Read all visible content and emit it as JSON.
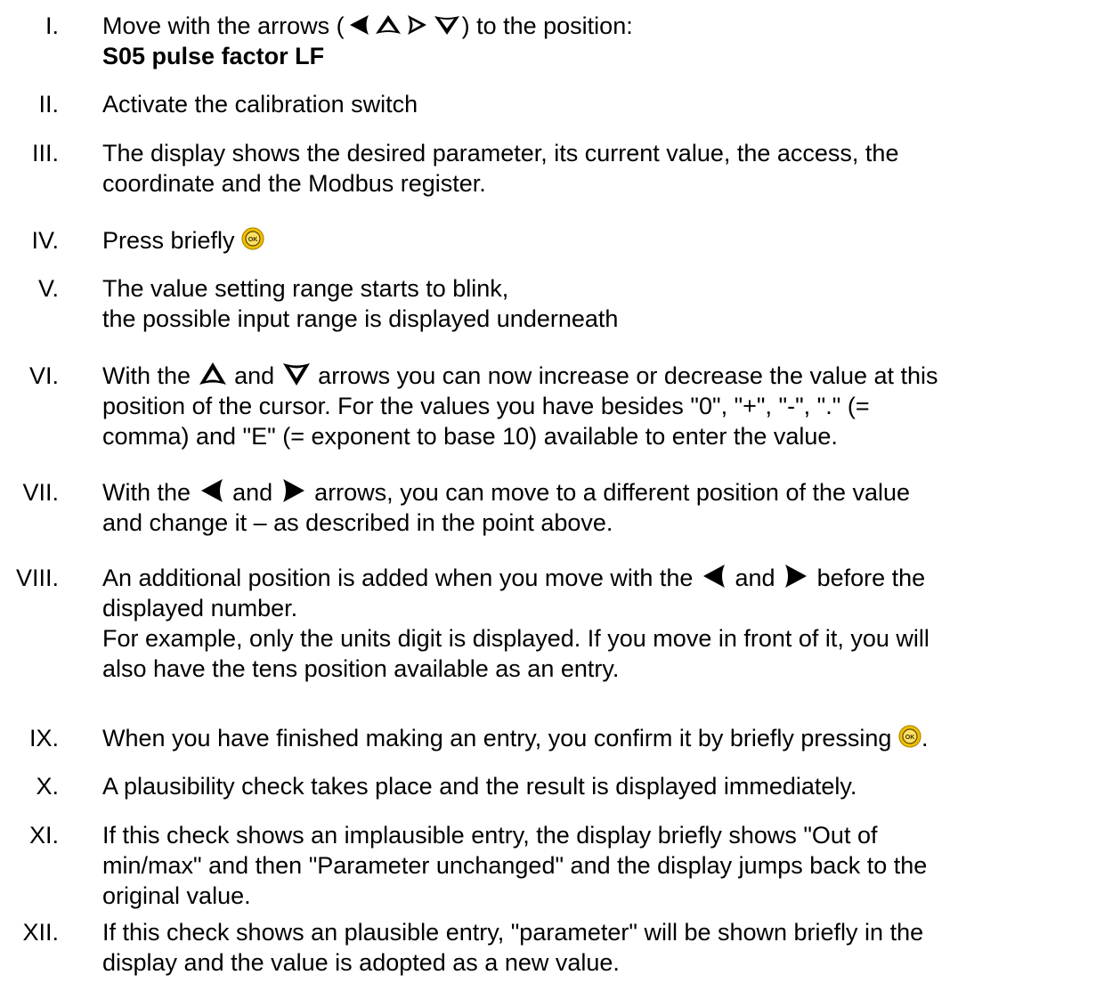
{
  "steps": [
    {
      "num": "I.",
      "pre": "Move with the arrows (",
      "post": ") to the position:",
      "bold": "S05 pulse factor LF"
    },
    {
      "num": "II.",
      "text": "Activate the calibration switch"
    },
    {
      "num": "III.",
      "l1": "The display shows the desired parameter, its current value, the access, the",
      "l2": "coordinate and the Modbus register."
    },
    {
      "num": "IV.",
      "text": "Press briefly"
    },
    {
      "num": "V.",
      "l1": "The value setting range starts to blink,",
      "l2": "the possible input range is displayed underneath"
    },
    {
      "num": "VI.",
      "a": "With the",
      "b": "and",
      "c": "arrows you can now increase or decrease the value at this",
      "l2": "position of the cursor. For the values you have besides \"0\", \"+\", \"-\", \".\" (=",
      "l3": "comma) and \"E\" (= exponent to base 10) available to enter the value."
    },
    {
      "num": "VII.",
      "a": "With the",
      "b": "and",
      "c": "arrows, you can move to a different position of the value",
      "l2": "and change it – as described in the point above."
    },
    {
      "num": "VIII.",
      "a": "An additional position is added when you move with the",
      "b": "and",
      "c": "before the",
      "l2": "displayed number.",
      "l3": "For example, only the units digit is displayed. If you move in front of it, you will",
      "l4": "also have the tens position available as an entry."
    },
    {
      "num": "IX.",
      "text": "When you have finished making an entry, you confirm it by briefly pressing",
      "end": "."
    },
    {
      "num": "X.",
      "text": "A plausibility check takes place and the result is displayed immediately."
    },
    {
      "num": "XI.",
      "l1": "If this check shows an implausible entry, the display briefly shows \"Out of",
      "l2": "min/max\" and then \"Parameter unchanged\" and the display jumps back to the",
      "l3": "original value."
    },
    {
      "num": "XII.",
      "l1": "If this check shows an plausible entry, \"parameter\" will be shown briefly in the",
      "l2": "display and the value is adopted as a new value."
    }
  ],
  "icons": {
    "ok_label": "OK",
    "ok_color": "#f2c000",
    "arrow_color": "#000000"
  }
}
